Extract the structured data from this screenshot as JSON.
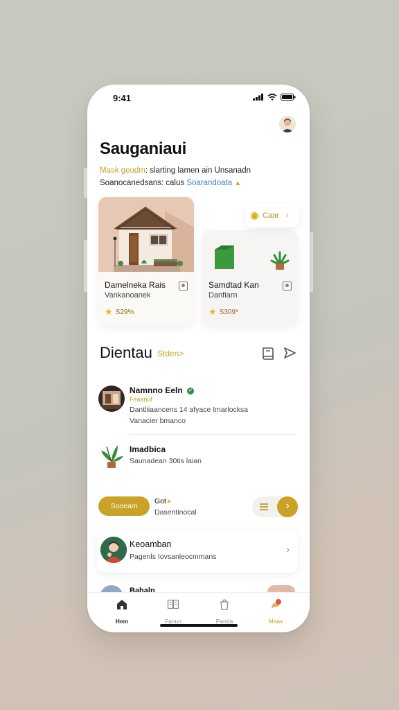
{
  "status_bar": {
    "time": "9:41"
  },
  "header": {
    "title": "Sauganiaui",
    "subtitle_accent": "Mask geudm",
    "subtitle_rest": ": slarting lamen ain Unsanadn",
    "subtitle2_rest": "Soanocanedsans: calus ",
    "subtitle2_link": "Soarandoata"
  },
  "chip": {
    "label": "Caar",
    "icon": "coin-icon"
  },
  "cards": [
    {
      "title": "Damelneka Rais",
      "subtitle": "Vankanoanek",
      "price": "S29%"
    },
    {
      "title": "Samdtad Kan",
      "subtitle": "Danfiarn",
      "price": "S309*"
    }
  ],
  "section": {
    "title": "Dientau",
    "link": "Stden>"
  },
  "rows": [
    {
      "name": "Namnno Eeln",
      "tag": "Feaanut",
      "line1": "Dantliiaancens 14 afyace Imarlocksa",
      "line2": "Vanacier bmanco"
    },
    {
      "name": "Imadbica",
      "line1": "Saunadean 30tis laian"
    }
  ],
  "action": {
    "button": "Sooeam",
    "title": "Got",
    "subtitle": "Dasentinocal"
  },
  "list_card": {
    "name": "Keoamban",
    "subtitle": "Pagenls Iovsanleocmmans"
  },
  "peek": {
    "label": "Bahaln"
  },
  "tabs": [
    {
      "label": "Hem"
    },
    {
      "label": "Fanun"
    },
    {
      "label": "Panda"
    },
    {
      "label": "Maas"
    }
  ],
  "colors": {
    "accent": "#c9a227",
    "link": "#3a86c4",
    "green": "#2f8f4e"
  }
}
